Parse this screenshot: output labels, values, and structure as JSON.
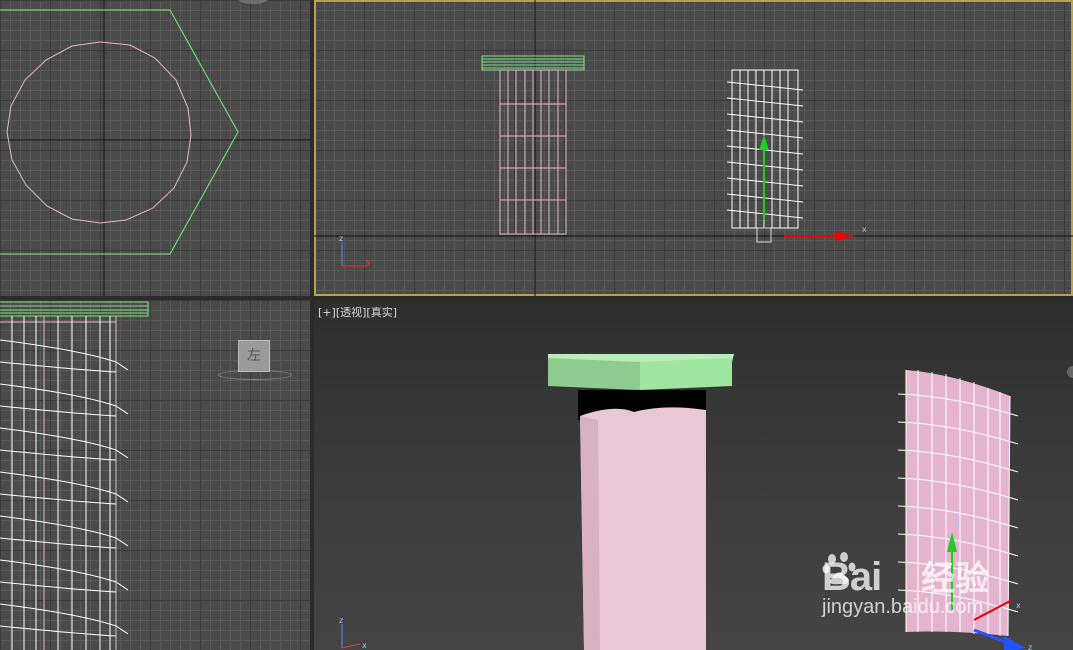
{
  "viewports": {
    "perspective": {
      "label_plus": "[+]",
      "label_view": "[透视]",
      "label_shading": "[真实]"
    }
  },
  "axis": {
    "x": "x",
    "y": "y",
    "z": "z"
  },
  "viewcube": {
    "left_face": "左"
  },
  "watermark": {
    "logo_text": "Bai",
    "logo_cn": "经验",
    "url": "jingyan.baidu.com"
  },
  "colors": {
    "viewport_bg": "#4a4a4a",
    "active_border": "#b8a24a",
    "green_object": "#7fe07f",
    "pink_object": "#e8b4c8",
    "white_wire": "#ffffff"
  }
}
